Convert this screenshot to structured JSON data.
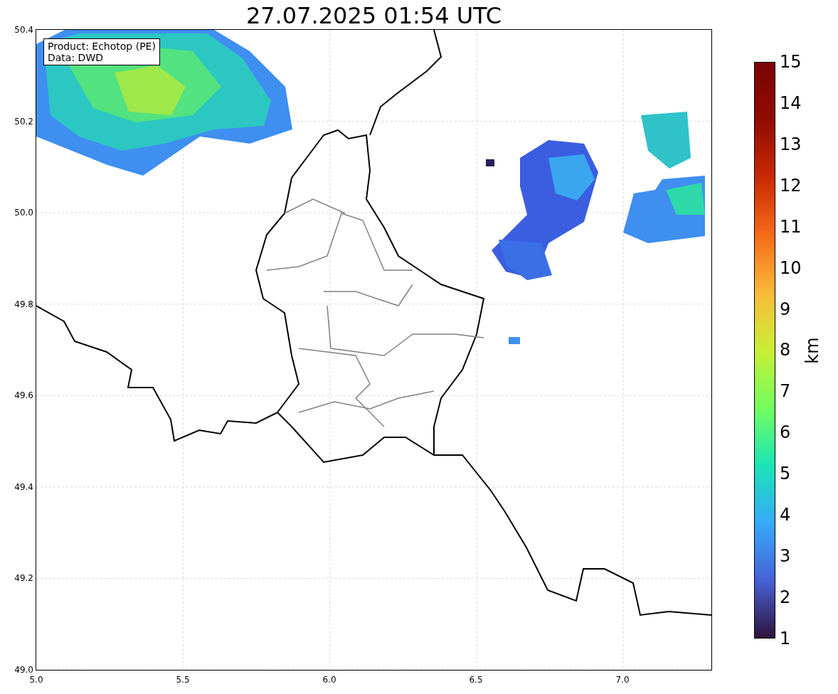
{
  "title": "27.07.2025 01:54 UTC",
  "info_box": {
    "lines": [
      "Product: Echotop (PE)",
      "Data: DWD"
    ]
  },
  "map": {
    "y_ticks": [
      "50.4",
      "50.2",
      "50.0",
      "49.8",
      "49.6",
      "49.4",
      "49.2",
      "49.0"
    ],
    "x_ticks": [
      "5.0",
      "5.5",
      "6.0",
      "6.5",
      "7.0"
    ]
  },
  "colorbar": {
    "label": "km",
    "ticks": [
      "15",
      "14",
      "13",
      "12",
      "11",
      "10",
      "9",
      "8",
      "7",
      "6",
      "5",
      "4",
      "3",
      "2",
      "1"
    ]
  }
}
